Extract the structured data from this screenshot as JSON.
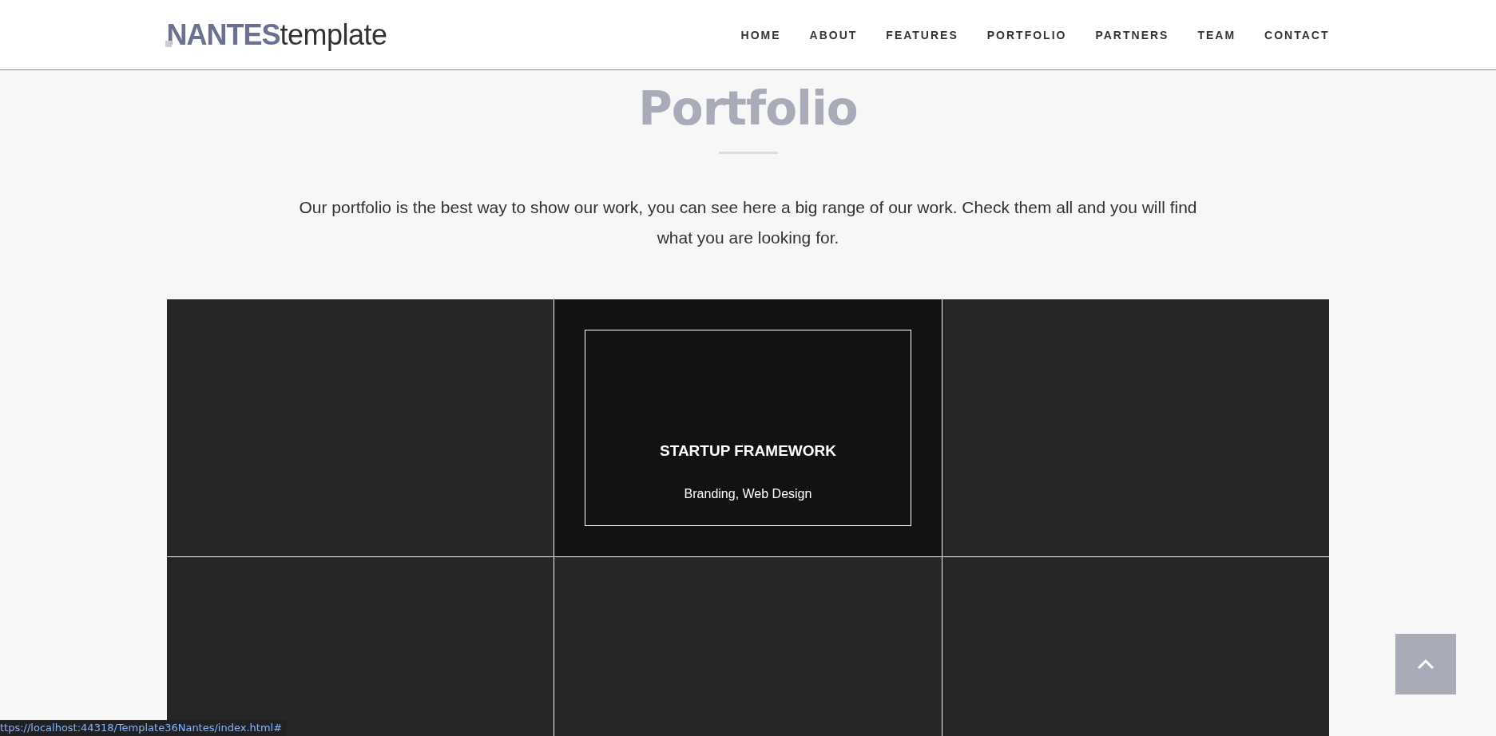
{
  "header": {
    "logo": "**NANTES**template",
    "nav": [
      {
        "label": "HOME"
      },
      {
        "label": "ABOUT"
      },
      {
        "label": "FEATURES"
      },
      {
        "label": "PORTFOLIO"
      },
      {
        "label": "PARTNERS"
      },
      {
        "label": "TEAM"
      },
      {
        "label": "CONTACT"
      }
    ]
  },
  "portfolio": {
    "title": "Portfolio",
    "intro": "Our portfolio is the best way to show our work, you can see here a big range of our work. Check them all and you will find what you are looking for.",
    "items": [
      {
        "hovered": false
      },
      {
        "hovered": true,
        "title": "STARTUP FRAMEWORK",
        "categories": "Branding, Web Design"
      },
      {
        "hovered": false
      },
      {
        "hovered": false
      },
      {
        "hovered": false
      },
      {
        "hovered": false
      }
    ]
  },
  "status_bar": {
    "url": "ttps://localhost:44318/Template36Nantes/index.html#"
  }
}
